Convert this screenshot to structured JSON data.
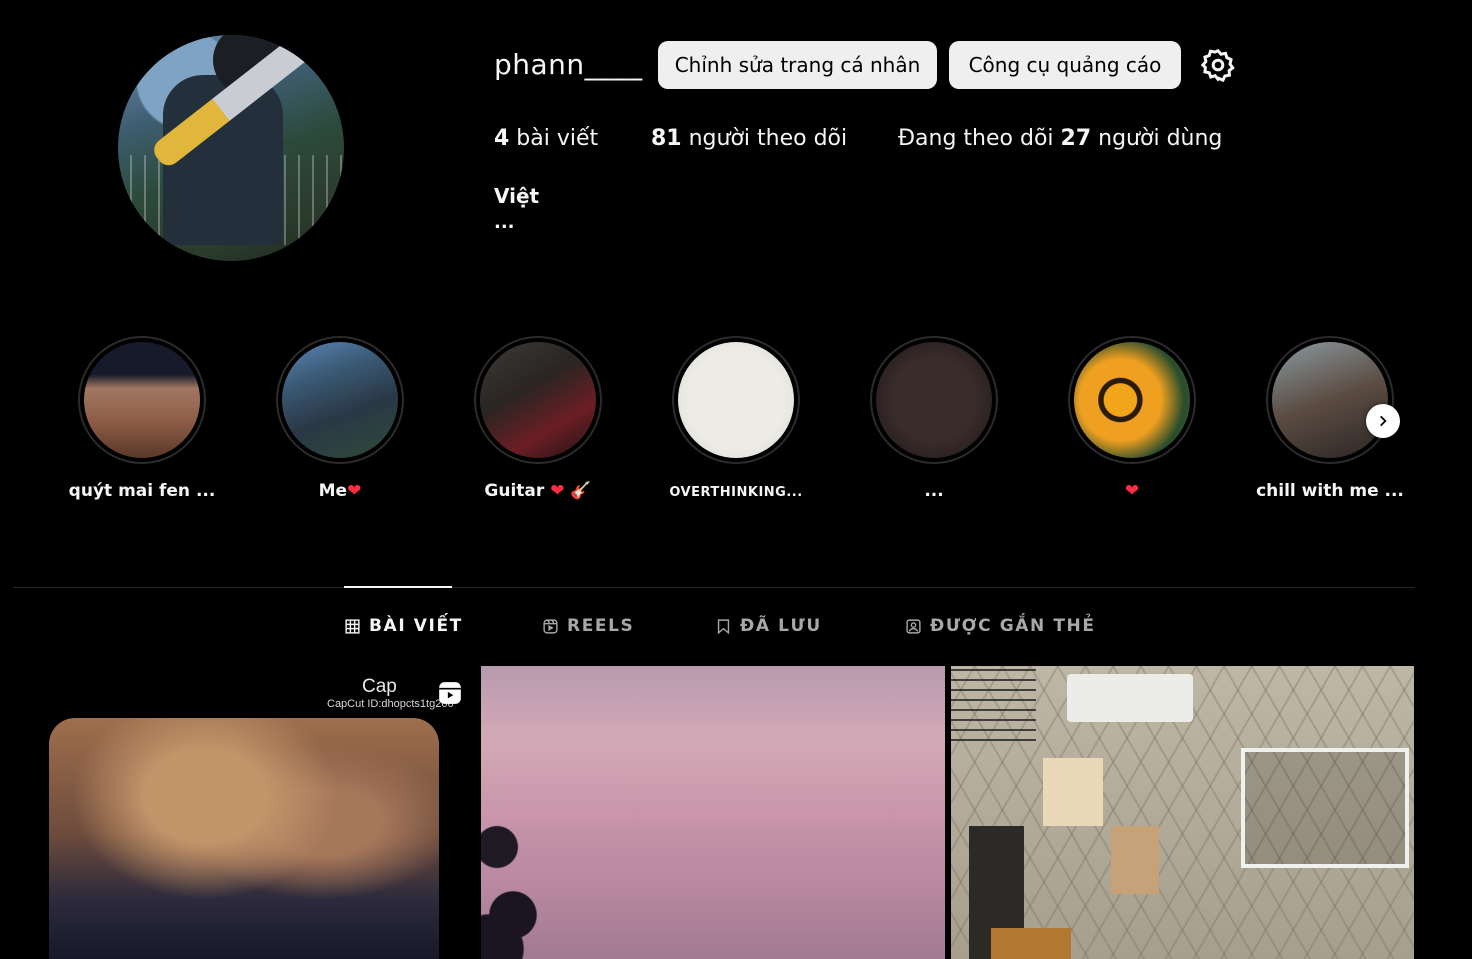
{
  "profile": {
    "username": "phann____",
    "edit_profile_label": "Chỉnh sửa trang cá nhân",
    "ad_tools_label": "Công cụ quảng cáo",
    "stats": {
      "posts_count": "4",
      "posts_label": " bài viết",
      "followers_count": "81",
      "followers_label": " người theo dõi",
      "following_prefix": "Đang theo dõi ",
      "following_count": "27",
      "following_label": " người dùng"
    },
    "full_name": "Việt",
    "bio": "..."
  },
  "highlights": [
    {
      "title": "quýt mai fen ..."
    },
    {
      "title": "Me",
      "heart": "❤"
    },
    {
      "title": "Guitar ",
      "heart": "❤",
      "extra": " 🎸"
    },
    {
      "title": "OVERTHINKING..."
    },
    {
      "title": "..."
    },
    {
      "title": "",
      "heart": "❤"
    },
    {
      "title": "chill with me ..."
    }
  ],
  "tabs": {
    "posts": "BÀI VIẾT",
    "reels": "REELS",
    "saved": "ĐÃ LƯU",
    "tagged": "ĐƯỢC GẮN THẺ"
  },
  "posts": {
    "post1_capcut": "Cap",
    "post1_capcut_id": "CapCut ID:dhopcts1tg206"
  },
  "icons": {
    "settings": "gear-icon",
    "next": "chevron-right-icon",
    "posts_tab": "grid-icon",
    "reels_tab": "reels-icon",
    "saved_tab": "bookmark-icon",
    "tagged_tab": "tagged-user-icon",
    "reel_badge": "reel-icon"
  }
}
